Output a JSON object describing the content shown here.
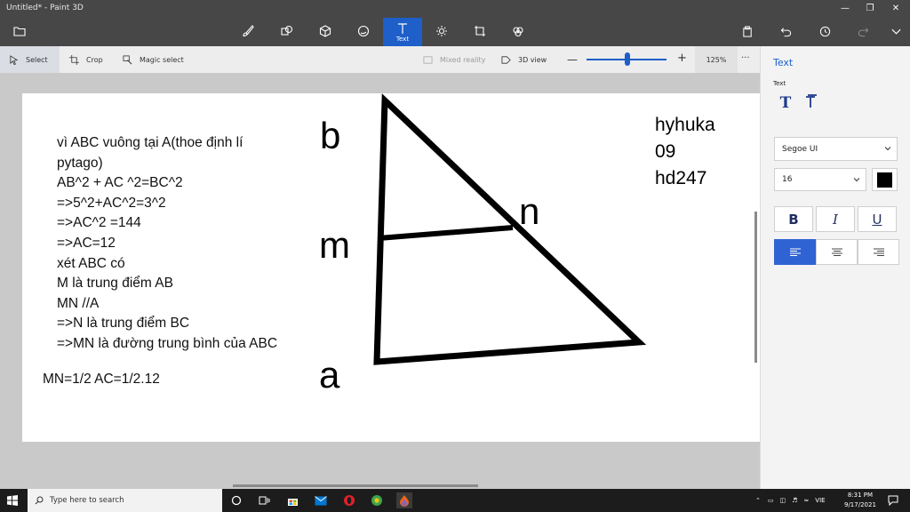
{
  "window": {
    "title": "Untitled* - Paint 3D"
  },
  "toolbar": {
    "text_label": "Text"
  },
  "subbar": {
    "select": "Select",
    "crop": "Crop",
    "magic_select": "Magic select",
    "mixed_reality": "Mixed reality",
    "view_3d": "3D view",
    "zoom": "125%"
  },
  "canvas": {
    "notes": [
      "vì ABC vuông tại A(thoe định lí",
      "pytago)",
      "AB^2 + AC ^2=BC^2",
      "=>5^2+AC^2=3^2",
      "=>AC^2 =144",
      "=>AC=12",
      "xét ABC có",
      "M là trung điểm AB",
      "MN //A",
      "=>N là trung điểm BC",
      "=>MN là đường trung bình của ABC"
    ],
    "result": "MN=1/2 AC=1/2.12",
    "labels": {
      "b": "b",
      "m": "m",
      "a": "a",
      "n": "n"
    },
    "signature": [
      "hyhuka",
      "09",
      "hd247"
    ]
  },
  "panel": {
    "title": "Text",
    "subtitle": "Text",
    "font": "Segoe UI",
    "size": "16",
    "bold": "B",
    "italic": "I",
    "underline": "U",
    "text_color": "#000000"
  },
  "taskbar": {
    "search_placeholder": "Type here to search",
    "lang": "VIE",
    "time": "8:31 PM",
    "date": "9/17/2021"
  },
  "colors": {
    "accent": "#1e5fc9",
    "titlebar": "#474747"
  }
}
